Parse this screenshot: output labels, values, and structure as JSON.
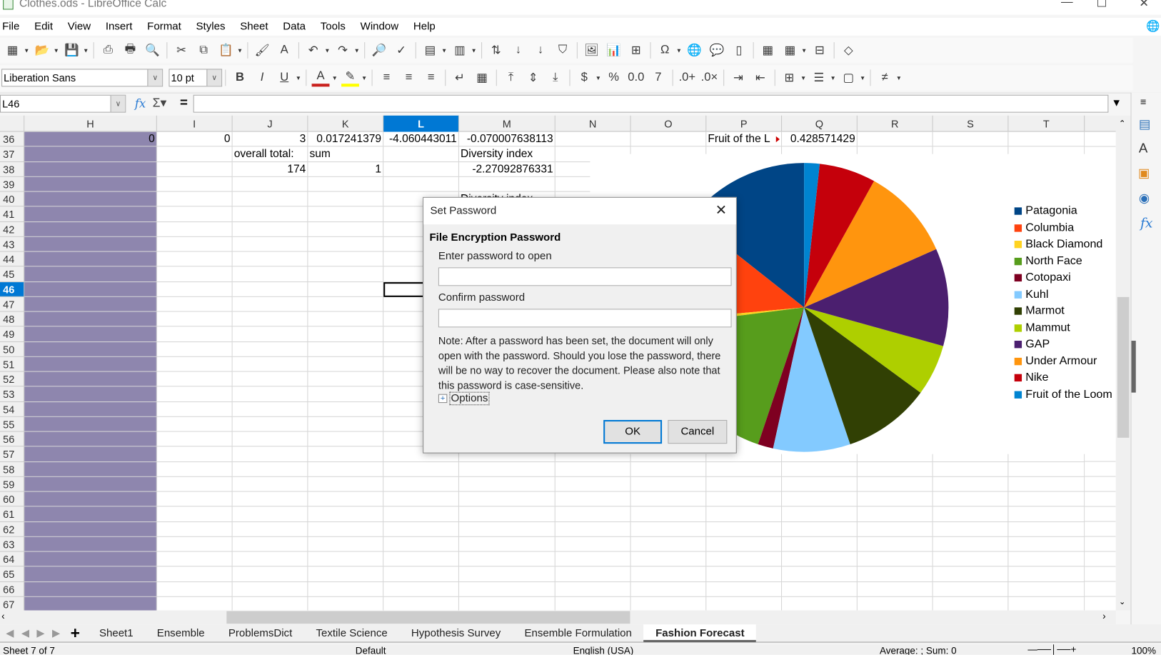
{
  "window": {
    "title": "Clothes.ods - LibreOffice Calc",
    "controls": [
      "minimize",
      "maximize",
      "close"
    ]
  },
  "menu": [
    "File",
    "Edit",
    "View",
    "Insert",
    "Format",
    "Styles",
    "Sheet",
    "Data",
    "Tools",
    "Window",
    "Help"
  ],
  "toolbar1": [
    "new-icon",
    "open-icon",
    "save-icon",
    "export-pdf-icon",
    "print-icon",
    "print-preview-icon",
    "cut-icon",
    "copy-icon",
    "paste-icon",
    "clone-formatting-icon",
    "clear-formatting-icon",
    "undo-icon",
    "redo-icon",
    "find-replace-icon",
    "spelling-icon",
    "row-icon",
    "column-icon",
    "sort-icon",
    "sort-ascending-icon",
    "sort-descending-icon",
    "autofilter-icon",
    "image-icon",
    "chart-icon",
    "pivot-table-icon",
    "special-character-icon",
    "hyperlink-icon",
    "comment-icon",
    "header-footer-icon",
    "define-print-area-icon",
    "freeze-rows-columns-icon",
    "split-window-icon",
    "shapes-icon"
  ],
  "toolbar2": {
    "font_name": "Liberation Sans",
    "font_size": "10 pt",
    "icons": [
      "bold-icon",
      "italic-icon",
      "underline-icon",
      "font-color-icon",
      "highlight-color-icon",
      "align-left-icon",
      "align-center-icon",
      "align-right-icon",
      "wrap-text-icon",
      "merge-cells-icon",
      "align-top-icon",
      "center-vertically-icon",
      "align-bottom-icon",
      "currency-icon",
      "percent-icon",
      "number-format-icon",
      "date-icon",
      "add-decimal-icon",
      "delete-decimal-icon",
      "increase-indent-icon",
      "decrease-indent-icon",
      "borders-icon",
      "border-style-icon",
      "border-color-icon",
      "conditional-format-icon"
    ]
  },
  "formula": {
    "name_box": "L46",
    "value": ""
  },
  "columns": [
    "H",
    "I",
    "J",
    "K",
    "L",
    "M",
    "N",
    "O",
    "P",
    "Q",
    "R",
    "S",
    "T"
  ],
  "selected_column": "L",
  "rows": [
    36,
    37,
    38,
    39,
    40,
    41,
    42,
    43,
    44,
    45,
    46,
    47,
    48,
    49,
    50,
    51,
    52,
    53,
    54,
    55,
    56,
    57,
    58,
    59,
    60,
    61,
    62,
    63,
    64,
    65,
    66,
    67
  ],
  "selected_row": 46,
  "selected_cell": "L46",
  "cells": {
    "H36": "0",
    "I36": "0",
    "J36": "3",
    "K36": "0.017241379",
    "L36": "-4.060443011",
    "M36": "-0.070007638113",
    "P36": "Fruit of the L",
    "Q36": "0.428571429",
    "J37": "overall total:",
    "K37": "sum",
    "M37": "Diversity index",
    "J38": "174",
    "K38": "1",
    "M38": "-2.27092876331",
    "M40": "Diversity index"
  },
  "highlight_color": "#8e86ae",
  "chart_data": {
    "type": "pie",
    "title": "",
    "legend_position": "right",
    "categories": [
      "Patagonia",
      "Columbia",
      "Black Diamond",
      "North Face",
      "Cotopaxi",
      "Kuhl",
      "Marmot",
      "Mammut",
      "GAP",
      "Under Armour",
      "Nike",
      "Fruit of the Loom"
    ],
    "values": [
      25,
      21,
      1,
      31,
      3,
      15,
      17,
      10,
      19,
      18,
      11,
      3
    ],
    "colors": [
      "#004586",
      "#ff420e",
      "#ffd320",
      "#579d1c",
      "#7e0021",
      "#83caff",
      "#314004",
      "#aecf00",
      "#4b1f6f",
      "#ff950e",
      "#c5000b",
      "#0084d1"
    ]
  },
  "dialog": {
    "title": "Set Password",
    "heading": "File Encryption Password",
    "open_label": "Enter password to open",
    "open_value": "",
    "confirm_label": "Confirm password",
    "confirm_value": "",
    "note": "Note: After a password has been set, the document will only open with the password. Should you lose the password, there will be no way to recover the document. Please also note that this password is case-sensitive.",
    "options": "Options",
    "ok": "OK",
    "cancel": "Cancel"
  },
  "sheet_tabs": [
    "Sheet1",
    "Ensemble",
    "ProblemsDict",
    "Textile Science",
    "Hypothesis Survey",
    "Ensemble Formulation",
    "Fashion Forecast"
  ],
  "active_tab": "Fashion Forecast",
  "status": {
    "sheet": "Sheet 7 of 7",
    "style": "Default",
    "language": "English (USA)",
    "summary": "Average: ; Sum: 0",
    "zoom": "100%"
  }
}
